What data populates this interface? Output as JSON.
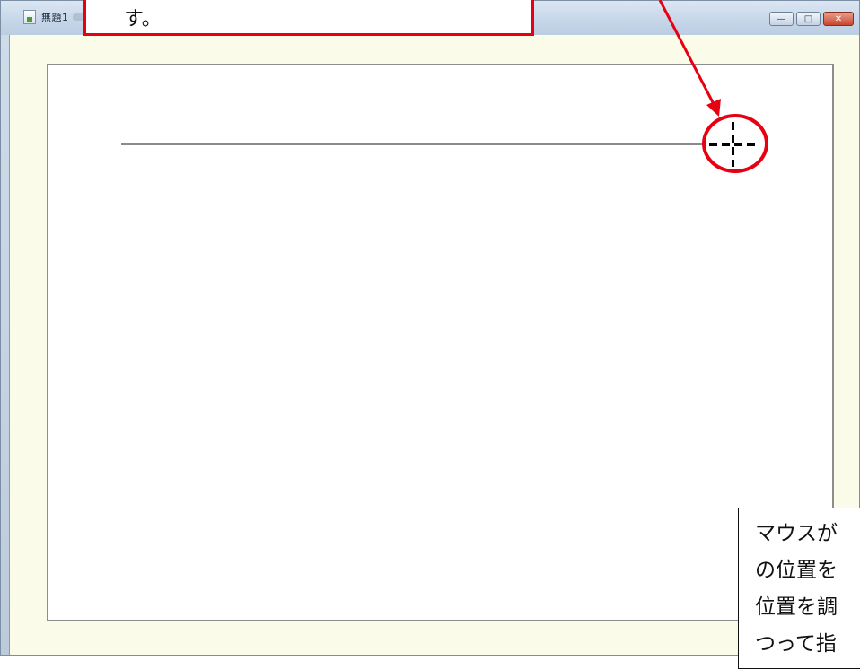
{
  "window": {
    "title": "無題1",
    "controls": {
      "minimize": "—",
      "maximize": "□",
      "close": "✕"
    }
  },
  "annotation_top": {
    "text": "す。",
    "border_color": "#e60012"
  },
  "annotation_bottom": {
    "lines": [
      "マウスが",
      "の位置を",
      "位置を調",
      "つって指"
    ]
  },
  "cursor": {
    "icon": "crosshair-icon",
    "highlight_color": "#e60012"
  }
}
